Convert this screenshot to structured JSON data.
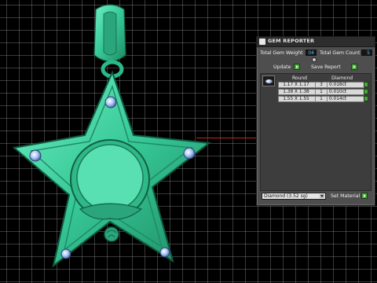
{
  "panel": {
    "title": "GEM REPORTER",
    "total_weight_label": "Total Gem Weight",
    "total_weight_value": "04",
    "total_count_label": "Total Gem Count",
    "total_count_value": "5",
    "update_label": "Update",
    "save_report_label": "Save Report",
    "table": {
      "headers": [
        "Round",
        "Diamond"
      ],
      "rows": [
        {
          "size": "1.17 X 1.17",
          "count": "3",
          "weight": "0.018ct"
        },
        {
          "size": "1.38 X 1.38",
          "count": "1",
          "weight": "0.010ct"
        },
        {
          "size": "1.55 X 1.55",
          "count": "1",
          "weight": "0.014ct"
        }
      ]
    },
    "material_select_value": "Diamond   (3.52 sg)",
    "set_material_label": "Set Material"
  },
  "colors": {
    "model_green": "#3fd3a3",
    "gem_blue": "#9fc0f0",
    "grid": "#8a8a8a",
    "accent_red": "#cc2222",
    "button_green": "#48a83a"
  }
}
